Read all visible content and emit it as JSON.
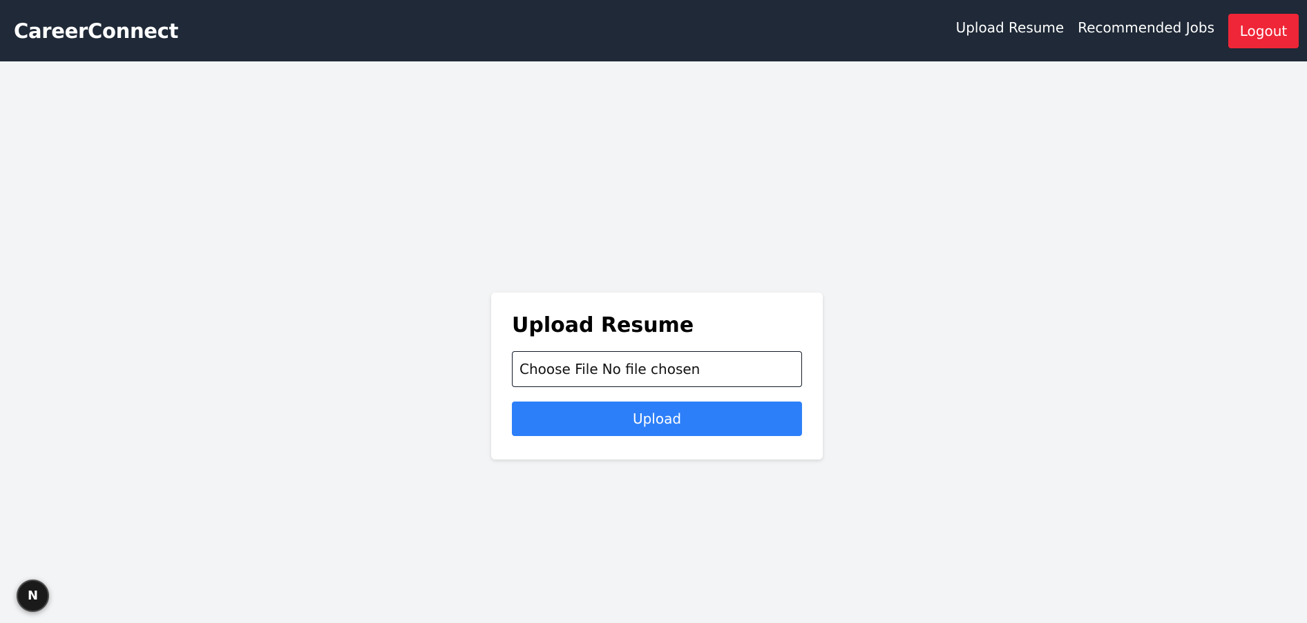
{
  "navbar": {
    "brand": "CareerConnect",
    "links": [
      {
        "label": "Upload Resume"
      },
      {
        "label": "Recommended Jobs"
      }
    ],
    "logout_label": "Logout"
  },
  "upload_card": {
    "title": "Upload Resume",
    "choose_file_label": "Choose File",
    "file_status": "No file chosen",
    "upload_label": "Upload"
  },
  "dev_badge": {
    "label": "N",
    "icon": "nextjs-icon"
  },
  "colors": {
    "navbar_bg": "#1f2937",
    "logout_bg": "#ef2637",
    "upload_bg": "#2d7ff9",
    "page_bg": "#f3f4f6"
  }
}
